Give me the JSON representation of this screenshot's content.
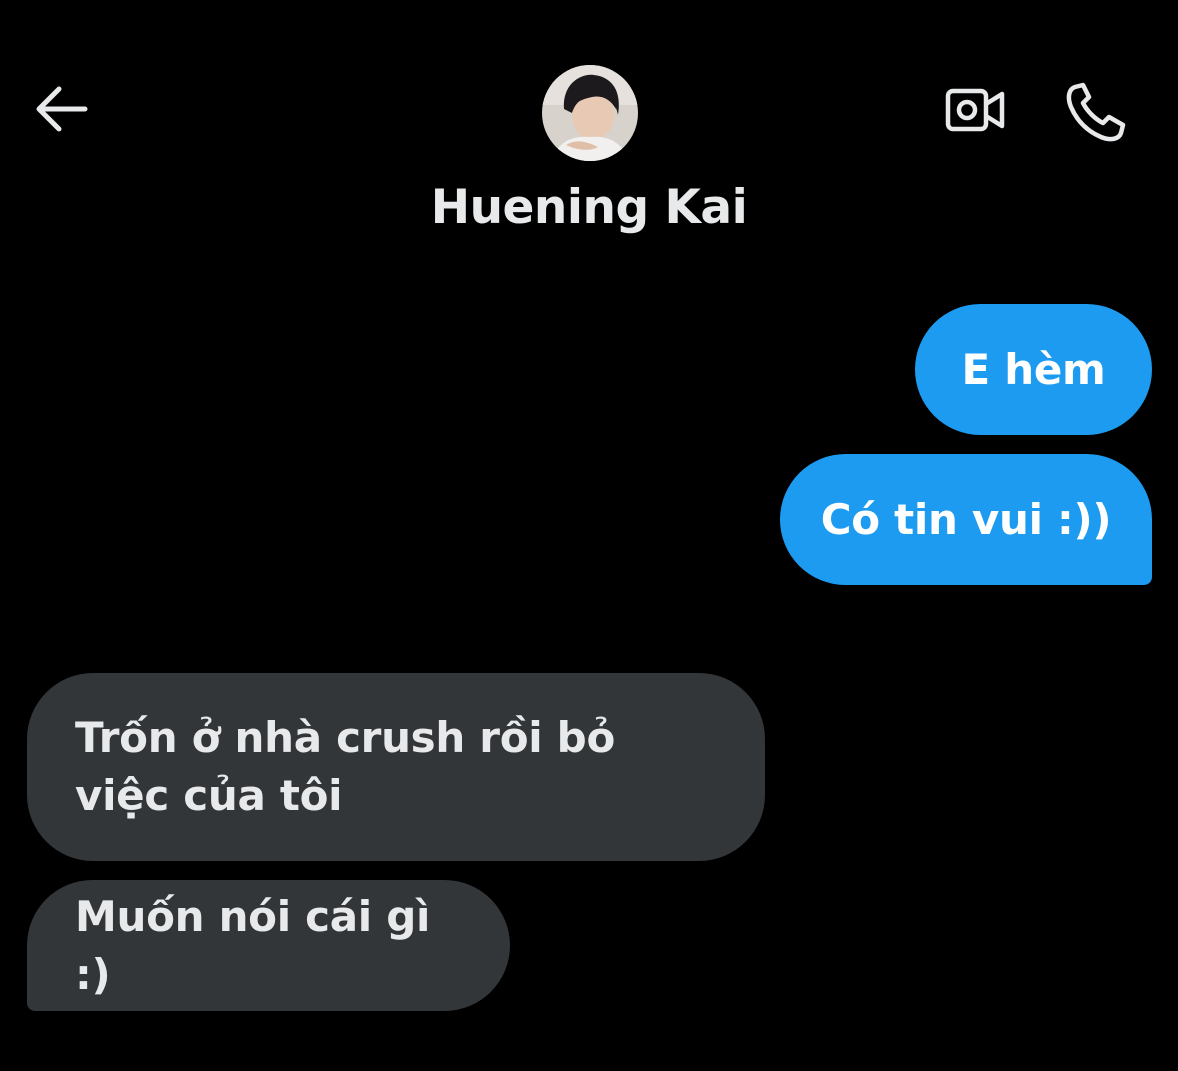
{
  "header": {
    "contact_name": "Huening Kai"
  },
  "icons": {
    "back": "arrow-left-icon",
    "video": "video-camera-icon",
    "call": "phone-icon"
  },
  "colors": {
    "background": "#000000",
    "sent_bubble": "#1d9bf0",
    "received_bubble": "#333639",
    "text": "#e7e9ea"
  },
  "messages": [
    {
      "direction": "sent",
      "text": "E hèm"
    },
    {
      "direction": "sent",
      "text": "Có tin vui :))"
    },
    {
      "direction": "received",
      "text": "Trốn ở nhà crush rồi bỏ việc của tôi"
    },
    {
      "direction": "received",
      "text": "Muốn nói cái gì :)"
    }
  ]
}
